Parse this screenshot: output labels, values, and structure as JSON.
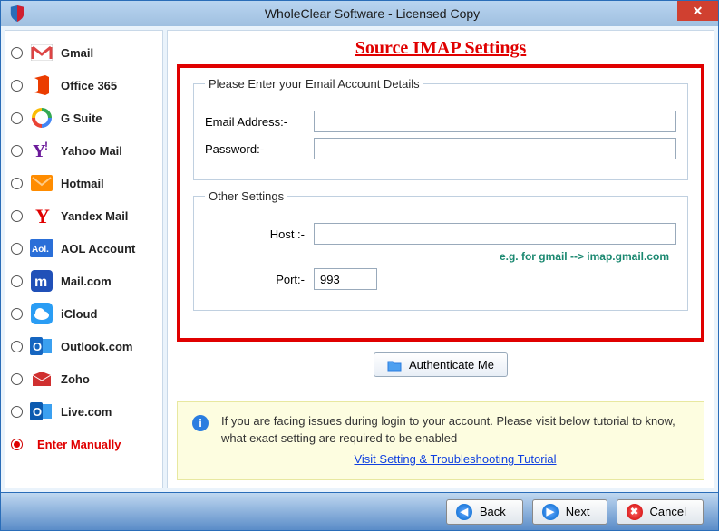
{
  "window": {
    "title": "WholeClear Software - Licensed Copy"
  },
  "sidebar": {
    "items": [
      {
        "label": "Gmail"
      },
      {
        "label": "Office 365"
      },
      {
        "label": "G Suite"
      },
      {
        "label": "Yahoo Mail"
      },
      {
        "label": "Hotmail"
      },
      {
        "label": "Yandex Mail"
      },
      {
        "label": "AOL Account"
      },
      {
        "label": "Mail.com"
      },
      {
        "label": "iCloud"
      },
      {
        "label": "Outlook.com"
      },
      {
        "label": "Zoho"
      },
      {
        "label": "Live.com"
      },
      {
        "label": "Enter Manually"
      }
    ],
    "selected_index": 12
  },
  "main": {
    "heading": "Source IMAP Settings",
    "account_legend": "Please Enter your Email Account Details",
    "email_label": "Email Address:-",
    "password_label": "Password:-",
    "email_value": "",
    "password_value": "",
    "other_legend": "Other Settings",
    "host_label": "Host :-",
    "host_value": "",
    "host_hint": "e.g. for gmail -->  imap.gmail.com",
    "port_label": "Port:-",
    "port_value": "993",
    "auth_button": "Authenticate Me",
    "info_text": "If you are facing issues during login to your account. Please visit below tutorial to know, what exact setting are required to be enabled",
    "info_link": "Visit Setting & Troubleshooting Tutorial"
  },
  "footer": {
    "back": "Back",
    "next": "Next",
    "cancel": "Cancel"
  }
}
